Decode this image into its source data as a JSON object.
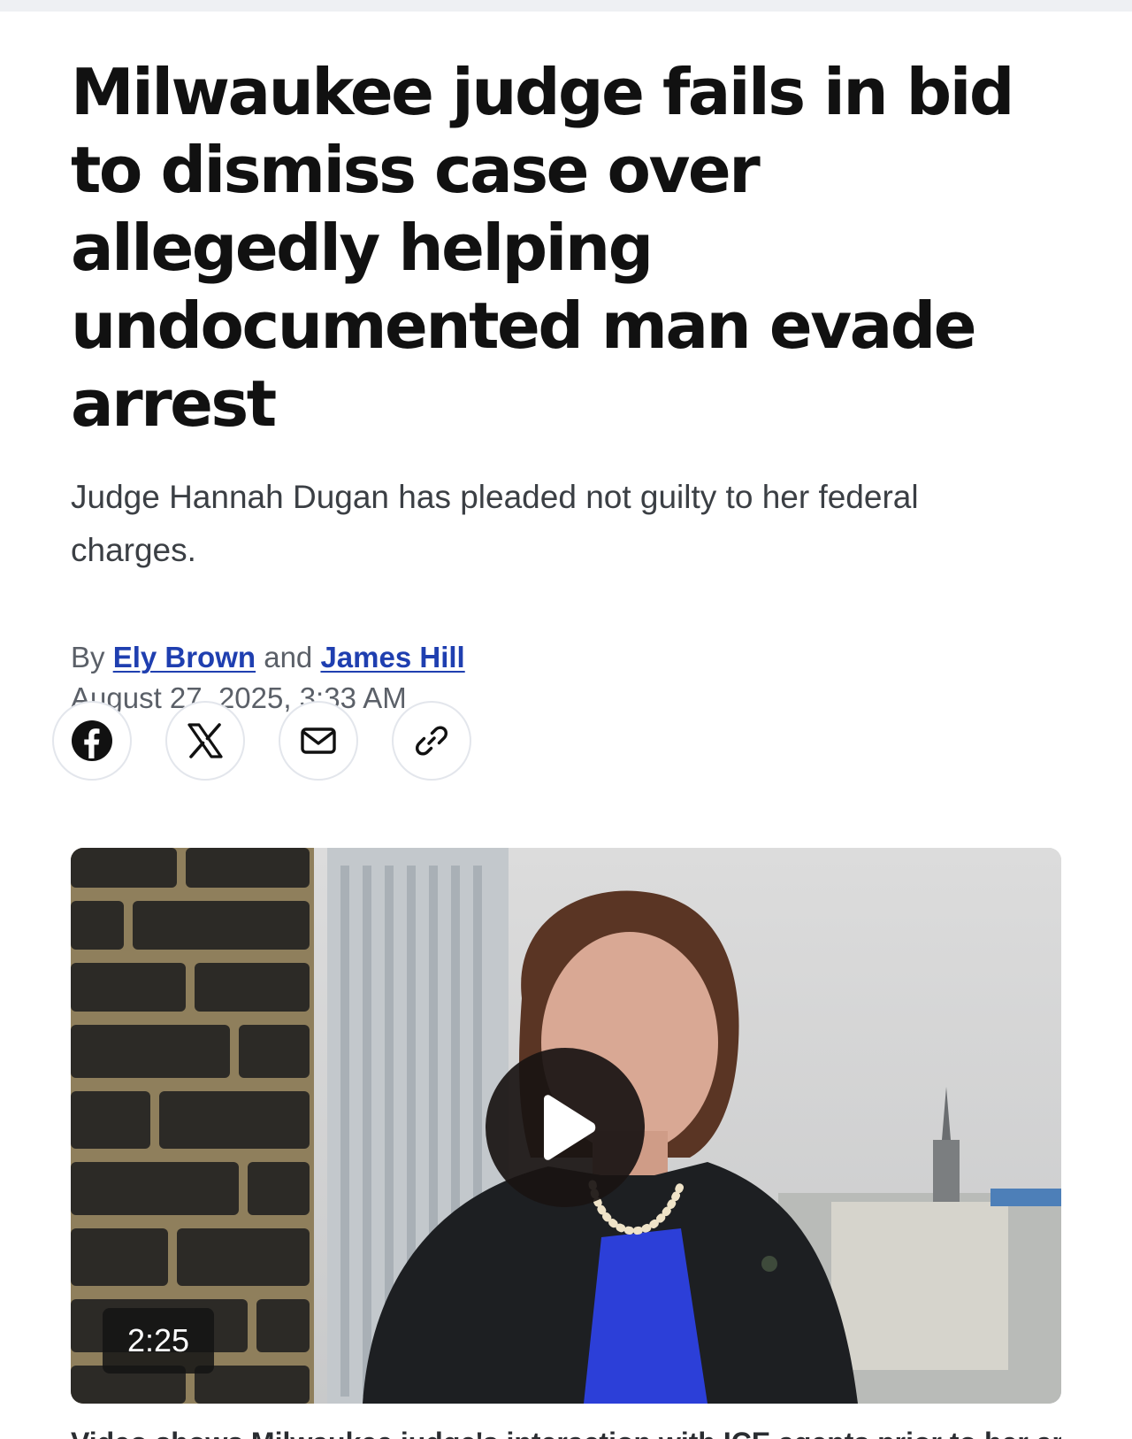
{
  "article": {
    "headline": "Milwaukee judge fails in bid to dismiss case over allegedly helping undocumented man evade arrest",
    "dek": "Judge Hannah Dugan has pleaded not guilty to her federal charges.",
    "byline": {
      "prefix": "By",
      "author_1": "Ely Brown",
      "conjunction": "and",
      "author_2": "James Hill"
    },
    "date": "August 27, 2025, 3:33 AM"
  },
  "share": {
    "buttons": [
      {
        "icon": "facebook-icon"
      },
      {
        "icon": "x-icon"
      },
      {
        "icon": "email-icon"
      },
      {
        "icon": "link-icon"
      }
    ]
  },
  "video": {
    "duration": "2:25",
    "play_icon": "play-icon"
  },
  "caption_peek": "Video shows Milwaukee judge's interaction with ICE agents prior to her arrest"
}
